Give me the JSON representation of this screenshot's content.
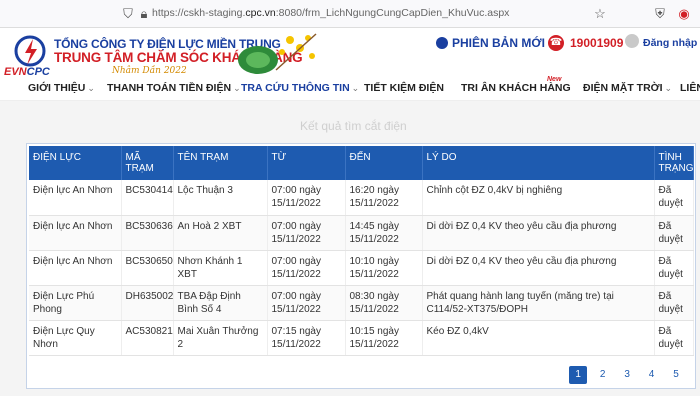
{
  "browser": {
    "url_prefix": "https://cskh-staging.",
    "url_domain": "cpc.vn",
    "url_suffix": ":8080/frm_LichNgungCungCapDien_KhuVuc.aspx"
  },
  "header": {
    "logo_evn": "EVN",
    "logo_cpc": "CPC",
    "company": "TỔNG CÔNG TY ĐIỆN LỰC MIỀN TRUNG",
    "center": "TRUNG TÂM CHĂM SÓC KHÁCH HÀNG",
    "tet": "Nhâm Dần 2022",
    "new_version": "PHIÊN BẢN MỚI",
    "hotline": "19001909",
    "login": "Đăng nhập"
  },
  "nav": {
    "items": [
      {
        "label": "GIỚI THIỆU",
        "caret": "⌄"
      },
      {
        "label": "THANH TOÁN TIỀN ĐIỆN",
        "caret": "⌄"
      },
      {
        "label": "TRA CỨU THÔNG TIN",
        "caret": "⌄"
      },
      {
        "label": "TIẾT KIỆM ĐIỆN",
        "caret": ""
      },
      {
        "label": "TRI ÂN KHÁCH HÀNG",
        "caret": ""
      },
      {
        "label": "ĐIỆN MẶT TRỜI",
        "caret": "⌄"
      },
      {
        "label": "LIÊN",
        "caret": ""
      }
    ],
    "new_badge": "New"
  },
  "page": {
    "faded_title": "Kết quả tìm cắt điện"
  },
  "table": {
    "columns": [
      "ĐIỆN LỰC",
      "MÃ TRẠM",
      "TÊN TRẠM",
      "TỪ",
      "ĐẾN",
      "LÝ DO",
      "TÌNH TRẠNG"
    ],
    "rows": [
      [
        "Điện lực An Nhơn",
        "BC530414",
        "Lộc Thuận 3",
        "07:00 ngày 15/11/2022",
        "16:20 ngày 15/11/2022",
        "Chỉnh cột ĐZ 0,4kV bị nghiêng",
        "Đã duyệt"
      ],
      [
        "Điện lực An Nhơn",
        "BC530636",
        "An Hoà 2 XBT",
        "07:00 ngày 15/11/2022",
        "14:45 ngày 15/11/2022",
        "Di dời ĐZ 0,4 KV theo yêu cầu địa phương",
        "Đã duyệt"
      ],
      [
        "Điện lực An Nhơn",
        "BC530650",
        "Nhơn Khánh 1 XBT",
        "07:00 ngày 15/11/2022",
        "10:10 ngày 15/11/2022",
        "Di dời ĐZ 0,4 KV theo yêu cầu địa phương",
        "Đã duyệt"
      ],
      [
        "Điện Lực Phú Phong",
        "DH635002",
        "TBA Đập Định Bình Số 4",
        "07:00 ngày 15/11/2022",
        "08:30 ngày 15/11/2022",
        "Phát quang hành lang tuyến (măng tre) tại C114/52-XT375/ĐOPH",
        "Đã duyệt"
      ],
      [
        "Điện Lực Quy Nhơn",
        "AC530821",
        "Mai Xuân Thưởng 2",
        "07:15 ngày 15/11/2022",
        "10:15 ngày 15/11/2022",
        "Kéo ĐZ 0,4kV",
        "Đã duyệt"
      ]
    ]
  },
  "pagination": {
    "pages": [
      "1",
      "2",
      "3",
      "4",
      "5"
    ],
    "active": "1"
  },
  "colors": {
    "brand_blue": "#1a3fa0",
    "brand_red": "#d21f26",
    "table_header": "#1e5bb0"
  }
}
